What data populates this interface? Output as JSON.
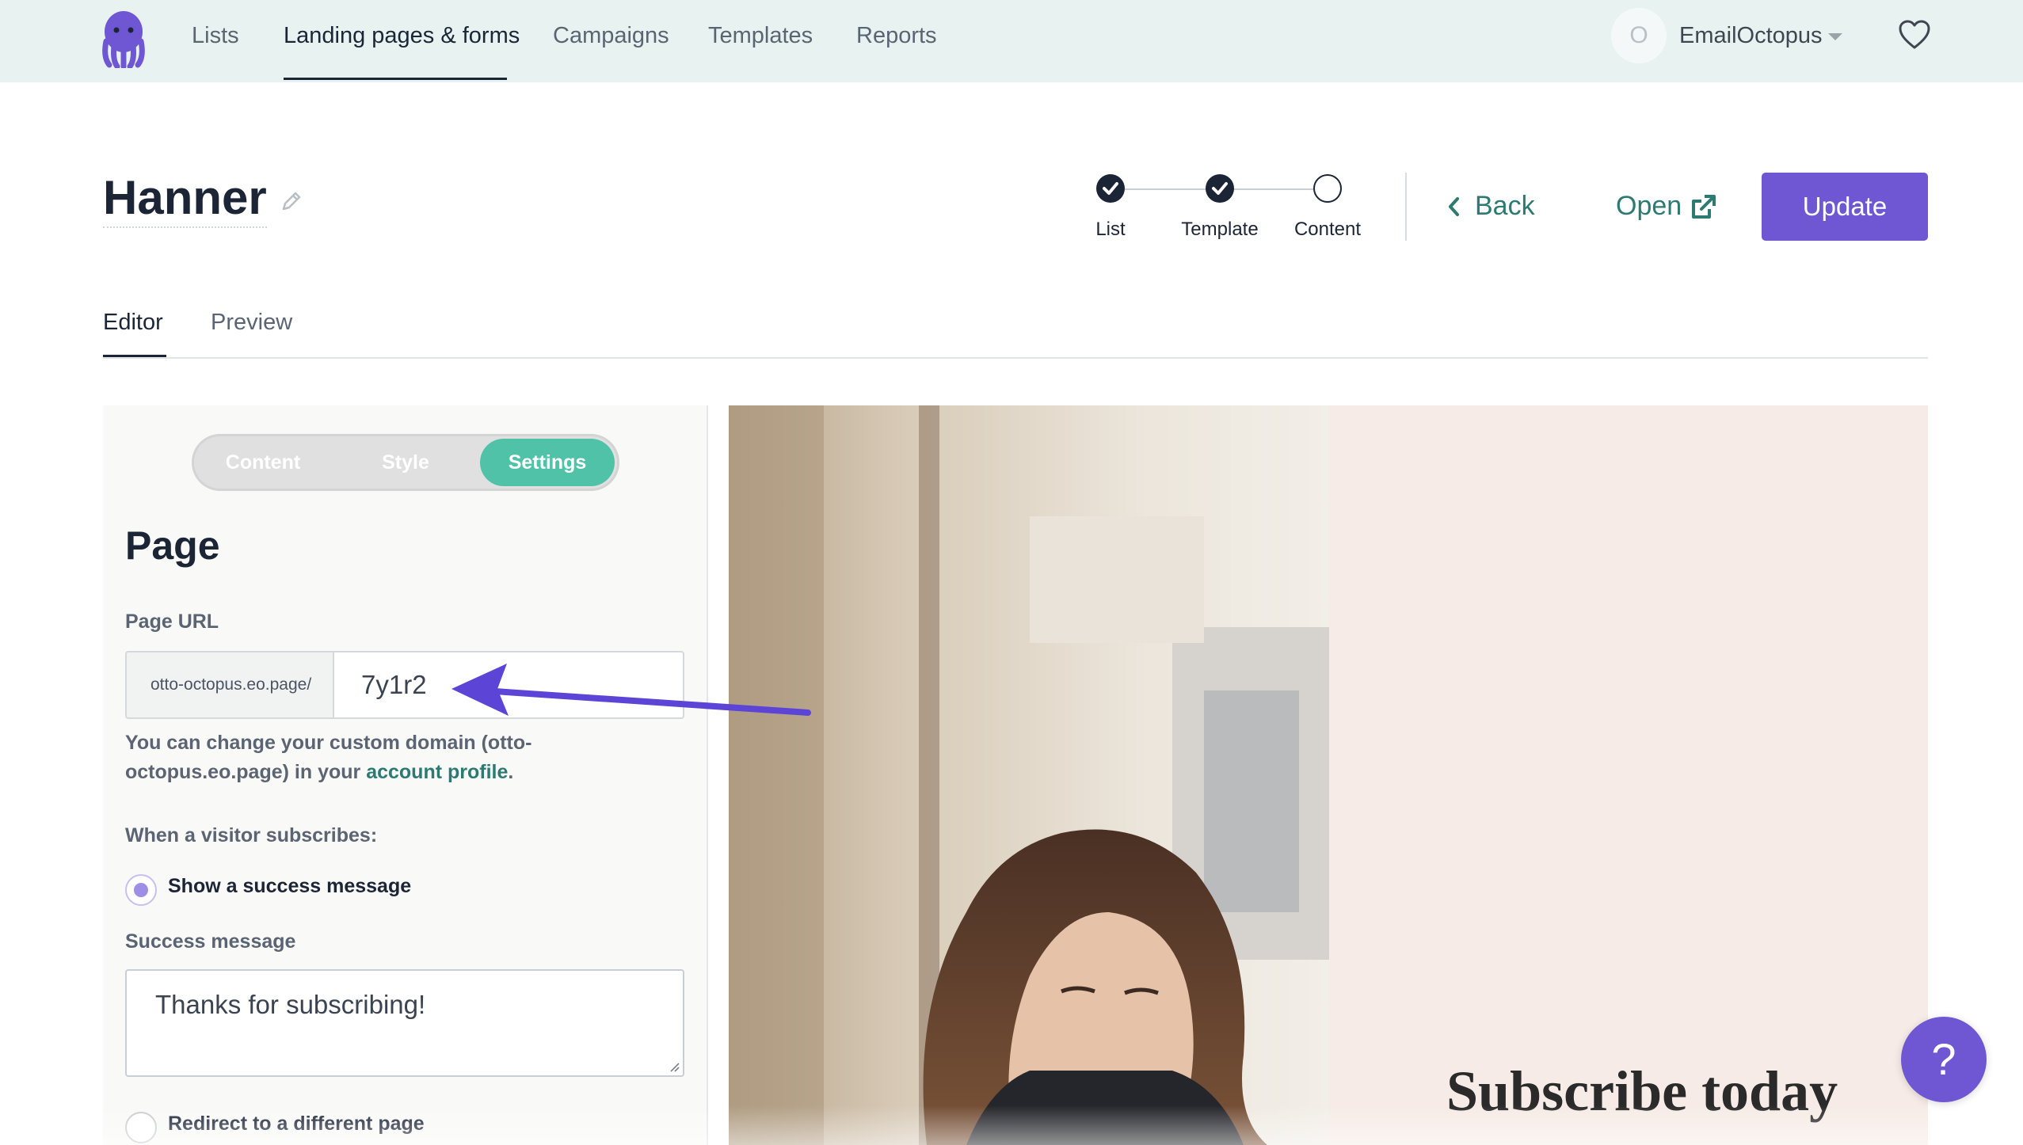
{
  "nav": {
    "items": [
      {
        "label": "Lists"
      },
      {
        "label": "Landing pages & forms"
      },
      {
        "label": "Campaigns"
      },
      {
        "label": "Templates"
      },
      {
        "label": "Reports"
      }
    ],
    "avatar_initial": "O",
    "account_name": "EmailOctopus",
    "icons": {
      "logo": "octopus-logo",
      "favorite": "heart-icon",
      "account_menu": "caret-down-icon"
    }
  },
  "header": {
    "title": "Hanner",
    "steps": [
      {
        "label": "List",
        "state": "done"
      },
      {
        "label": "Template",
        "state": "done"
      },
      {
        "label": "Content",
        "state": "current"
      }
    ],
    "back_label": "Back",
    "open_label": "Open",
    "update_label": "Update"
  },
  "editor_tabs": [
    {
      "label": "Editor",
      "active": true
    },
    {
      "label": "Preview",
      "active": false
    }
  ],
  "settings_panel": {
    "segments": [
      {
        "label": "Content",
        "active": false
      },
      {
        "label": "Style",
        "active": false
      },
      {
        "label": "Settings",
        "active": true
      }
    ],
    "section_title": "Page",
    "page_url_label": "Page URL",
    "url_prefix": "otto-octopus.eo.page/",
    "url_slug": "7y1r2",
    "help_text_before": "You can change your custom domain (otto-octopus.eo.page) in your ",
    "help_link": "account profile",
    "help_text_after": ".",
    "subscribe_label": "When a visitor subscribes:",
    "options": [
      {
        "label": "Show a success message",
        "checked": true
      },
      {
        "label": "Redirect to a different page",
        "checked": false
      }
    ],
    "success_label": "Success message",
    "success_message": "Thanks for subscribing!"
  },
  "preview": {
    "heading": "Subscribe today"
  },
  "help_button": "?",
  "colors": {
    "brand_purple": "#6f57d4",
    "teal_link": "#2c7a72",
    "segment_active": "#4fc2a8",
    "nav_bg": "#e8f3f1"
  }
}
